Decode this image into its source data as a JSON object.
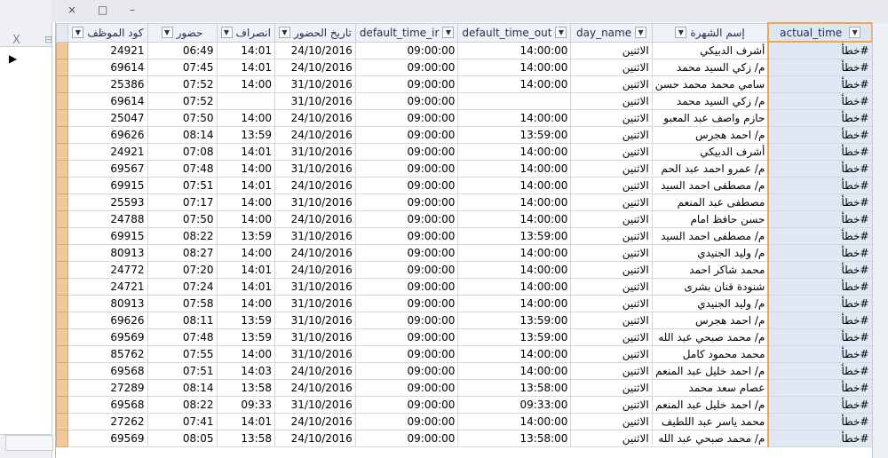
{
  "window_controls": {
    "close": "×",
    "restore": "□",
    "minimize": "–"
  },
  "left_pane": {
    "close_label": "X",
    "small_label": "⊟",
    "arrow": "▶"
  },
  "columns": [
    "كود الموظف",
    "حضور",
    "انصراف",
    "تاريخ الحضور",
    "default_time_ir",
    "default_time_out",
    "day_name",
    "إسم الشهرة",
    "actual_time"
  ],
  "rows": [
    [
      "24921",
      "06:49",
      "14:01",
      "24/10/2016",
      "09:00:00",
      "14:00:00",
      "الاثنين",
      "أشرف الدبيكي",
      "#خطأ"
    ],
    [
      "69614",
      "07:45",
      "14:01",
      "24/10/2016",
      "09:00:00",
      "14:00:00",
      "الاثنين",
      "م/ زكي السيد محمد",
      "#خطأ"
    ],
    [
      "25386",
      "07:52",
      "14:00",
      "31/10/2016",
      "09:00:00",
      "14:00:00",
      "الاثنين",
      "سامي محمد محمد حسن",
      "#خطأ"
    ],
    [
      "69614",
      "07:52",
      "",
      "31/10/2016",
      "09:00:00",
      "",
      "الاثنين",
      "م/ زكي السيد محمد",
      "#خطأ"
    ],
    [
      "25047",
      "07:50",
      "14:00",
      "24/10/2016",
      "09:00:00",
      "14:00:00",
      "الاثنين",
      "حازم واصف عبد المعبو",
      "#خطأ"
    ],
    [
      "69626",
      "08:14",
      "13:59",
      "24/10/2016",
      "09:00:00",
      "13:59:00",
      "الاثنين",
      "م/ احمد هجرس",
      "#خطأ"
    ],
    [
      "24921",
      "07:08",
      "14:01",
      "31/10/2016",
      "09:00:00",
      "14:00:00",
      "الاثنين",
      "أشرف الدبيكي",
      "#خطأ"
    ],
    [
      "69567",
      "07:48",
      "14:00",
      "31/10/2016",
      "09:00:00",
      "14:00:00",
      "الاثنين",
      "م/ عمرو احمد عبد الحم",
      "#خطأ"
    ],
    [
      "69915",
      "07:51",
      "14:01",
      "24/10/2016",
      "09:00:00",
      "14:00:00",
      "الاثنين",
      "م/ مصطفى احمد السيد",
      "#خطأ"
    ],
    [
      "25593",
      "07:17",
      "14:00",
      "31/10/2016",
      "09:00:00",
      "14:00:00",
      "الاثنين",
      "مصطفى عبد المنعم",
      "#خطأ"
    ],
    [
      "24788",
      "07:50",
      "14:00",
      "24/10/2016",
      "09:00:00",
      "14:00:00",
      "الاثنين",
      "حسن حافظ امام",
      "#خطأ"
    ],
    [
      "69915",
      "08:22",
      "13:59",
      "31/10/2016",
      "09:00:00",
      "13:59:00",
      "الاثنين",
      "م/ مصطفى احمد السيد",
      "#خطأ"
    ],
    [
      "80913",
      "08:27",
      "14:00",
      "24/10/2016",
      "09:00:00",
      "14:00:00",
      "الاثنين",
      "م/ وليد الجنيدي",
      "#خطأ"
    ],
    [
      "24772",
      "07:20",
      "14:01",
      "24/10/2016",
      "09:00:00",
      "14:00:00",
      "الاثنين",
      "محمد شاكر احمد",
      "#خطأ"
    ],
    [
      "24721",
      "07:24",
      "14:01",
      "31/10/2016",
      "09:00:00",
      "14:00:00",
      "الاثنين",
      "شنودة قنان بشرى",
      "#خطأ"
    ],
    [
      "80913",
      "07:58",
      "14:00",
      "31/10/2016",
      "09:00:00",
      "14:00:00",
      "الاثنين",
      "م/ وليد الجنيدي",
      "#خطأ"
    ],
    [
      "69626",
      "08:11",
      "13:59",
      "31/10/2016",
      "09:00:00",
      "13:59:00",
      "الاثنين",
      "م/ احمد هجرس",
      "#خطأ"
    ],
    [
      "69569",
      "07:48",
      "13:59",
      "31/10/2016",
      "09:00:00",
      "13:59:00",
      "الاثنين",
      "م/ محمد صبحي عبد الله",
      "#خطأ"
    ],
    [
      "85762",
      "07:55",
      "14:00",
      "31/10/2016",
      "09:00:00",
      "14:00:00",
      "الاثنين",
      "محمد محمود كامل",
      "#خطأ"
    ],
    [
      "69568",
      "07:51",
      "14:03",
      "24/10/2016",
      "09:00:00",
      "14:00:00",
      "الاثنين",
      "م/ احمد خليل عبد المنعم",
      "#خطأ"
    ],
    [
      "27289",
      "08:14",
      "13:58",
      "24/10/2016",
      "09:00:00",
      "13:58:00",
      "الاثنين",
      "عصام سعد محمد",
      "#خطأ"
    ],
    [
      "69568",
      "08:22",
      "09:33",
      "31/10/2016",
      "09:00:00",
      "09:33:00",
      "الاثنين",
      "م/ احمد خليل عبد المنعم",
      "#خطأ"
    ],
    [
      "27262",
      "07:41",
      "14:01",
      "24/10/2016",
      "09:00:00",
      "14:00:00",
      "الاثنين",
      "محمد ياسر عبد اللطيف",
      "#خطأ"
    ],
    [
      "69569",
      "08:05",
      "13:58",
      "24/10/2016",
      "09:00:00",
      "13:58:00",
      "الاثنين",
      "م/ محمد صبحي عبد الله",
      "#خطأ"
    ]
  ]
}
